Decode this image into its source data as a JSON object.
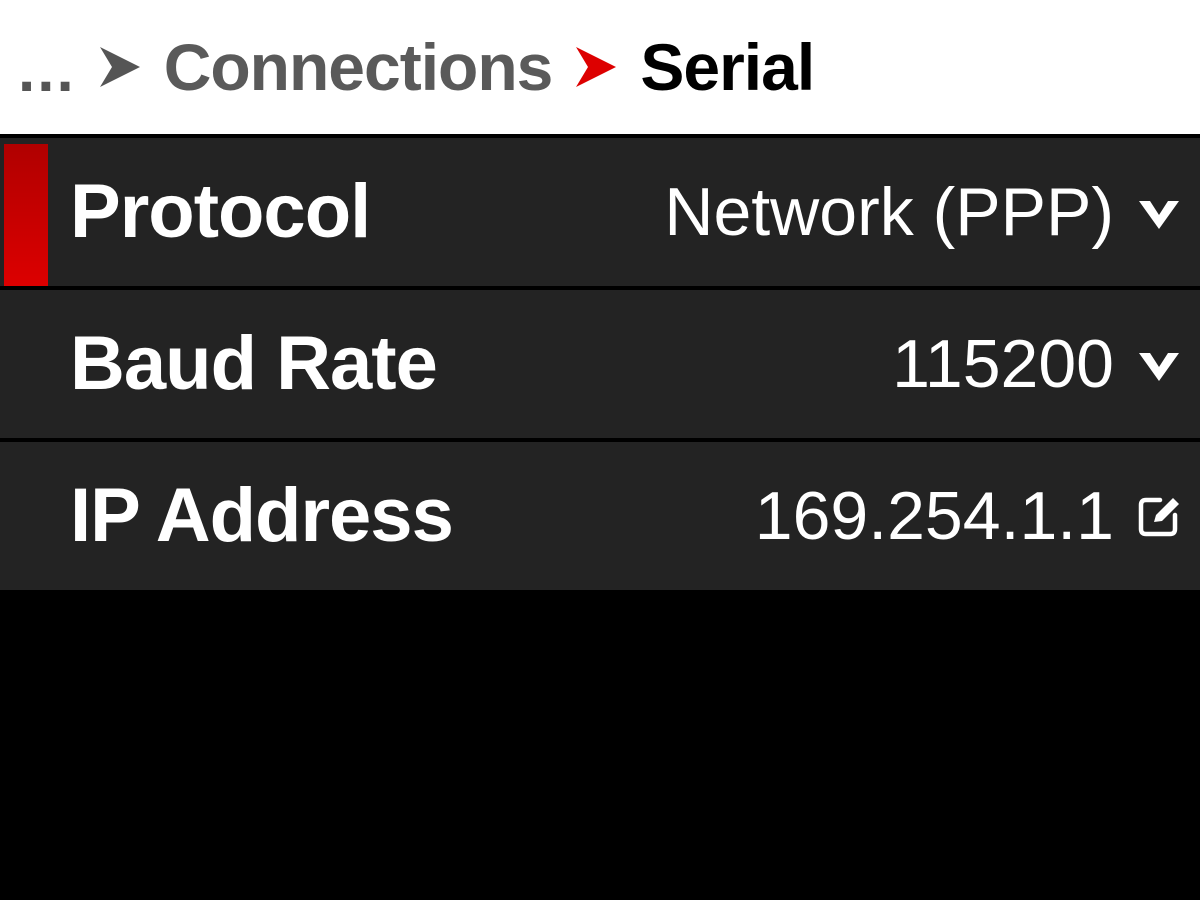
{
  "breadcrumb": {
    "ellipsis": "...",
    "parent": "Connections",
    "current": "Serial"
  },
  "settings": [
    {
      "label": "Protocol",
      "value": "Network (PPP)",
      "icon": "chevron-down-icon",
      "focused": true
    },
    {
      "label": "Baud Rate",
      "value": "115200",
      "icon": "chevron-down-icon",
      "focused": false
    },
    {
      "label": "IP Address",
      "value": "169.254.1.1",
      "icon": "edit-icon",
      "focused": false
    }
  ],
  "colors": {
    "accent": "#d40000",
    "row_background": "#232323",
    "background": "#000000",
    "header_background": "#ffffff"
  }
}
